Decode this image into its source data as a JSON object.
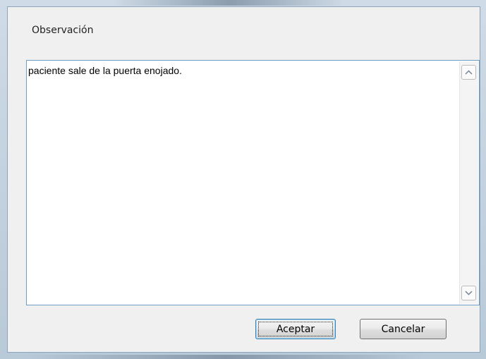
{
  "dialog": {
    "label": "Observación",
    "observation_text": "paciente sale de la puerta enojado.",
    "accept_label": "Aceptar",
    "cancel_label": "Cancelar"
  },
  "icons": {
    "scroll_up": "chevron-up-icon",
    "scroll_down": "chevron-down-icon"
  }
}
